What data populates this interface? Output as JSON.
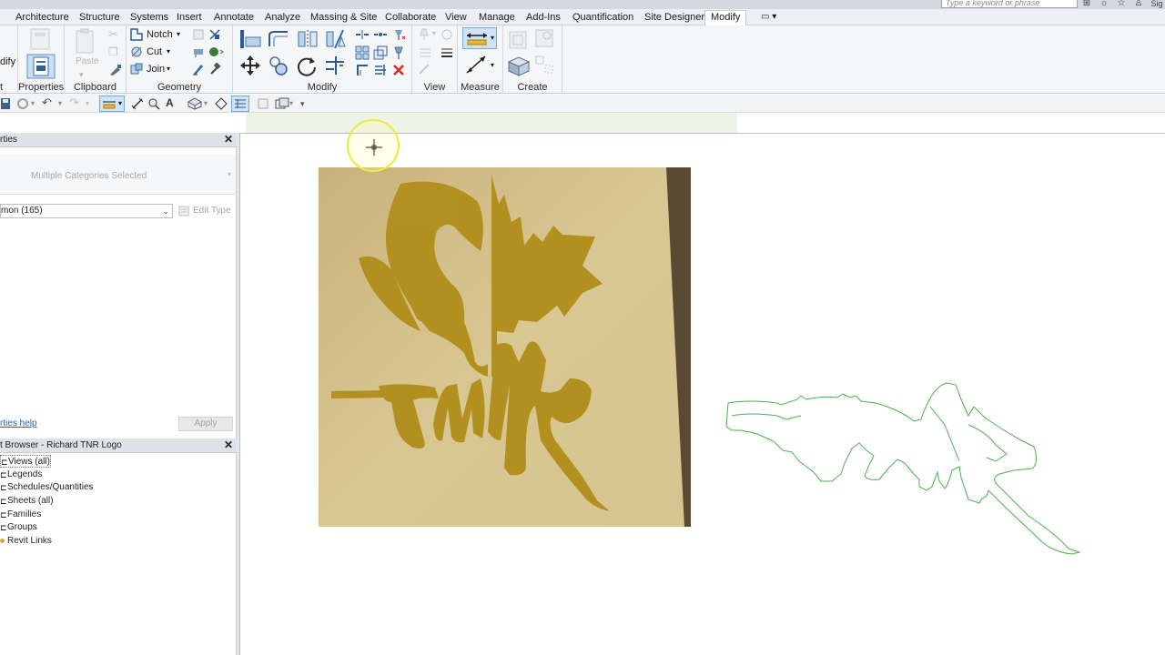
{
  "search": {
    "placeholder": "Type a keyword or phrase"
  },
  "tabs": [
    {
      "label": "Architecture"
    },
    {
      "label": "Structure"
    },
    {
      "label": "Systems"
    },
    {
      "label": "Insert"
    },
    {
      "label": "Annotate"
    },
    {
      "label": "Analyze"
    },
    {
      "label": "Massing & Site"
    },
    {
      "label": "Collaborate"
    },
    {
      "label": "View"
    },
    {
      "label": "Manage"
    },
    {
      "label": "Add-Ins"
    },
    {
      "label": "Quantification"
    },
    {
      "label": "Site Designer"
    },
    {
      "label": "Modify"
    }
  ],
  "ribbon": {
    "modify_cut_label": "dify",
    "select_cut_label": "t",
    "properties_label": "Properties",
    "clipboard_label": "Clipboard",
    "paste_label": "Paste",
    "geometry_label": "Geometry",
    "notch_label": "Notch",
    "cut_label": "Cut",
    "join_label": "Join",
    "modify_label": "Modify",
    "view_label": "View",
    "measure_label": "Measure",
    "create_label": "Create"
  },
  "properties": {
    "title": "rties",
    "type_selector": "Multiple Categories Selected",
    "instance_filter": "mon (165)",
    "edit_type": "Edit Type",
    "help_link": "rties help",
    "apply": "Apply"
  },
  "browser": {
    "title": "t Browser - Richard TNR Logo",
    "items": [
      {
        "label": "Views (all)"
      },
      {
        "label": "Legends"
      },
      {
        "label": "Schedules/Quantities"
      },
      {
        "label": "Sheets (all)"
      },
      {
        "label": "Families"
      },
      {
        "label": "Groups"
      },
      {
        "label": "Revit Links"
      }
    ]
  },
  "canvas": {
    "image_name": "TNR logo reference photo",
    "trace_name": "TNR model lines"
  },
  "colors": {
    "trace_green": "#4bb34b",
    "logo_gold": "#b08e1a",
    "paper": "#d8c48a",
    "cursor_ring": "#ecea3a"
  }
}
